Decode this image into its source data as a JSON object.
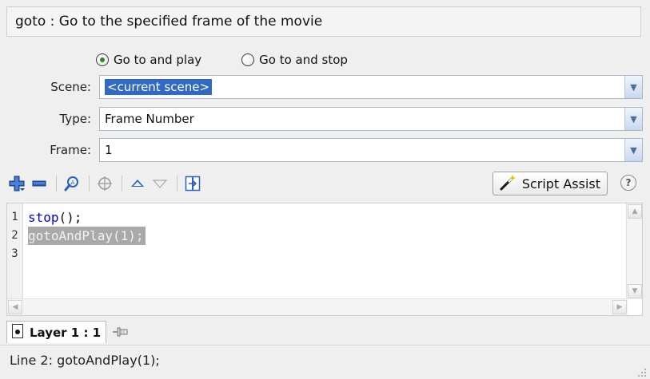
{
  "description": "goto : Go to the specified frame of the movie",
  "radios": {
    "option1": "Go to and play",
    "option2": "Go to and stop",
    "selected": "option1"
  },
  "form": {
    "scene_label": "Scene:",
    "scene_value": "<current scene>",
    "type_label": "Type:",
    "type_value": "Frame Number",
    "frame_label": "Frame:",
    "frame_value": "1"
  },
  "toolbar": {
    "script_assist_label": "Script Assist",
    "help_glyph": "?"
  },
  "editor": {
    "line_numbers": [
      "1",
      "2",
      "3"
    ],
    "line1_keyword": "stop",
    "line1_rest": "();",
    "line2": "gotoAndPlay(1);"
  },
  "tabs": {
    "layer_label": "Layer 1 : 1"
  },
  "status": {
    "text": "Line 2: gotoAndPlay(1);"
  },
  "colors": {
    "accent": "#316ac5",
    "selection_gray": "#a9a9a9",
    "keyword_blue": "#0000dd"
  },
  "icons": {
    "add": "plus-icon",
    "remove": "minus-icon",
    "find": "find-icon",
    "target": "target-icon",
    "move_up": "arrow-up-icon",
    "move_down": "arrow-down-icon",
    "insert": "insert-target-icon",
    "script_assist": "magic-wand-icon",
    "help": "help-icon",
    "pin": "pin-icon"
  }
}
